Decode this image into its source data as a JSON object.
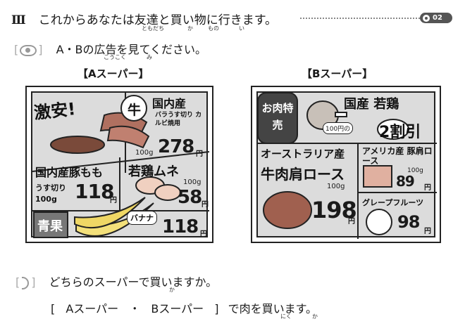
{
  "heading": {
    "roman": "Ⅲ",
    "text": "これからあなたは友達と買い物に行きます。",
    "ruby_tomodachi": "ともだち",
    "ruby_ka": "か",
    "ruby_mono": "もの",
    "ruby_i": "い",
    "track_no": "02",
    "track_icon": "cd-icon"
  },
  "instruction": {
    "icon": "eye-icon",
    "text": "A・Bの広告を見てください。",
    "ruby_koukoku": "こうこく",
    "ruby_mi": "み"
  },
  "store_a": {
    "title": "【Aスーパー】",
    "badge": "激安!",
    "items": [
      {
        "tag": "牛",
        "name": "国内産",
        "note": "バラうす切り カルビ焼用",
        "weight": "100g",
        "price": "278",
        "unit": "円"
      },
      {
        "name": "国内産豚もも",
        "note": "うす切り 100g",
        "price": "118",
        "unit": "円"
      },
      {
        "name": "若鶏ムネ",
        "weight": "100g",
        "price": "58",
        "unit": "円"
      },
      {
        "name": "青果",
        "tag": "バナナ",
        "price": "118",
        "unit": "円"
      }
    ]
  },
  "store_b": {
    "title": "【Bスーパー】",
    "badge": "お肉特売",
    "items": [
      {
        "name": "国産 若鶏",
        "note": "100円の",
        "price": "2割引"
      },
      {
        "name": "オーストラリア産",
        "sub": "牛肉肩ロース",
        "weight": "100g",
        "price": "198",
        "unit": "円"
      },
      {
        "name": "アメリカ産 豚肩ロース",
        "weight": "100g",
        "price": "89",
        "unit": "円"
      },
      {
        "name": "グレープフルーツ",
        "price": "98",
        "unit": "円"
      }
    ]
  },
  "question": {
    "icon": "ear-icon",
    "text": "どちらのスーパーで買いますか。",
    "ruby_ka": "か"
  },
  "answer": {
    "open": "[",
    "option_a": "Aスーパー",
    "sep": "・",
    "option_b": "Bスーパー",
    "close": "]",
    "suffix": "で肉を買います。",
    "ruby_niku": "にく",
    "ruby_ka": "か"
  }
}
